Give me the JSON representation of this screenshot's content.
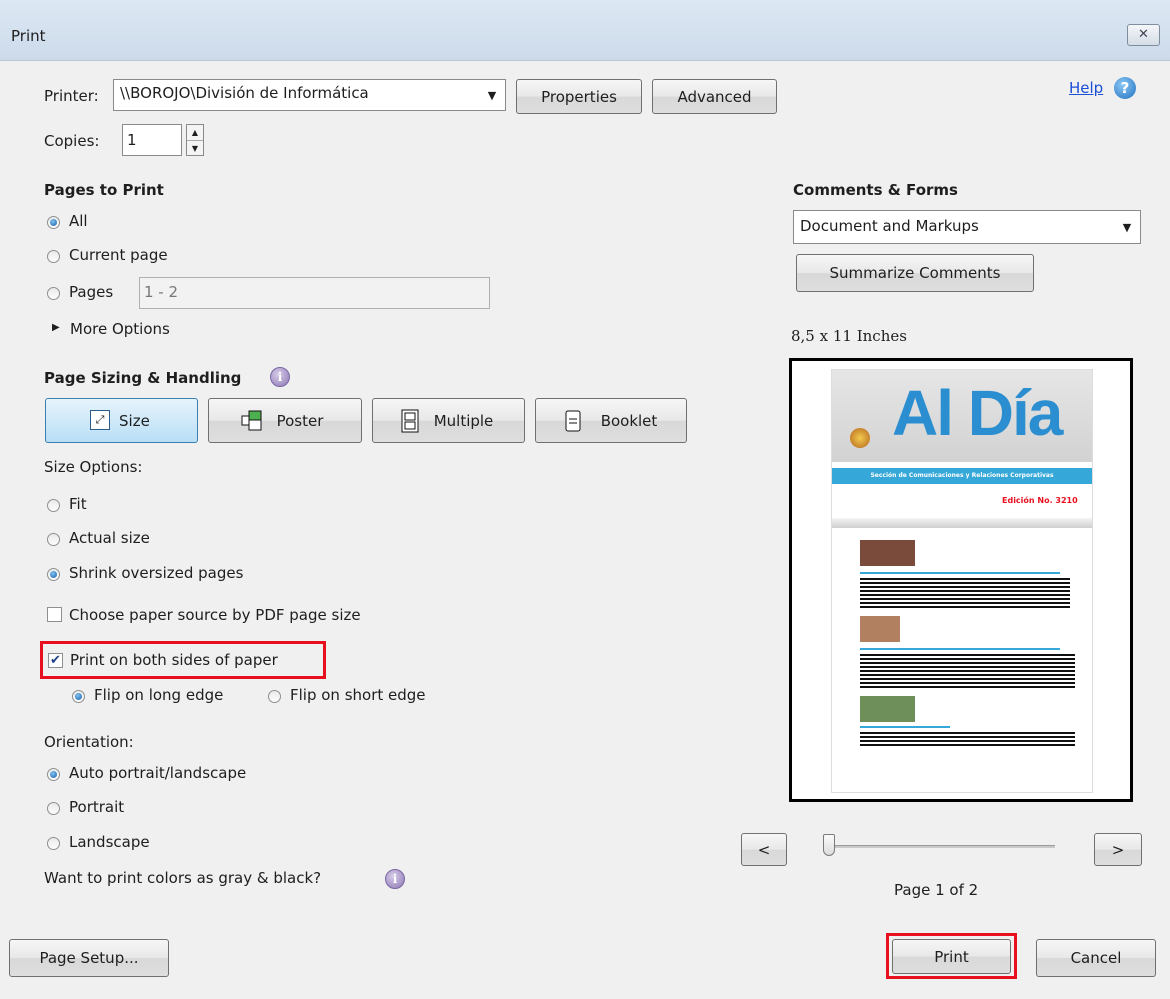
{
  "window": {
    "title": "Print",
    "close_glyph": "✕"
  },
  "printer": {
    "label": "Printer:",
    "value": "\\\\BOROJO\\División de Informática",
    "properties": "Properties",
    "advanced": "Advanced"
  },
  "help": {
    "label": "Help",
    "icon": "help-icon"
  },
  "copies": {
    "label": "Copies:",
    "value": "1"
  },
  "pages_to_print": {
    "heading": "Pages to Print",
    "all": "All",
    "current_page": "Current page",
    "pages": "Pages",
    "pages_value": "1 - 2",
    "more_options": "More Options",
    "selected": "All"
  },
  "page_sizing": {
    "heading": "Page Sizing & Handling",
    "tabs": [
      "Size",
      "Poster",
      "Multiple",
      "Booklet"
    ],
    "active_tab": "Size",
    "size_options_label": "Size Options:",
    "fit": "Fit",
    "actual_size": "Actual size",
    "shrink": "Shrink oversized pages",
    "selected": "Shrink oversized pages",
    "paper_source": "Choose paper source by PDF page size",
    "paper_source_checked": false,
    "both_sides": "Print on both sides of paper",
    "both_sides_checked": true,
    "flip_long": "Flip on long edge",
    "flip_short": "Flip on short edge",
    "flip_selected": "Flip on long edge"
  },
  "orientation": {
    "label": "Orientation:",
    "auto": "Auto portrait/landscape",
    "portrait": "Portrait",
    "landscape": "Landscape",
    "selected": "Auto portrait/landscape"
  },
  "gray": {
    "label": "Want to print colors as gray & black?"
  },
  "comments_forms": {
    "heading": "Comments & Forms",
    "value": "Document and Markups",
    "summarize": "Summarize Comments"
  },
  "preview": {
    "paper_size": "8,5 x 11 Inches",
    "prev": "<",
    "next": ">",
    "page_status": "Page 1 of 2",
    "slider_position": 0,
    "thumb": {
      "masthead": "Al Día",
      "banner": "Sección de Comunicaciones y Relaciones Corporativas",
      "edition": "Edición No. 3210"
    }
  },
  "footer": {
    "page_setup": "Page Setup...",
    "print": "Print",
    "cancel": "Cancel"
  },
  "colors": {
    "highlight": "#e8101e",
    "masthead_blue": "#2a8ed0",
    "banner_blue": "#35a7d8"
  }
}
